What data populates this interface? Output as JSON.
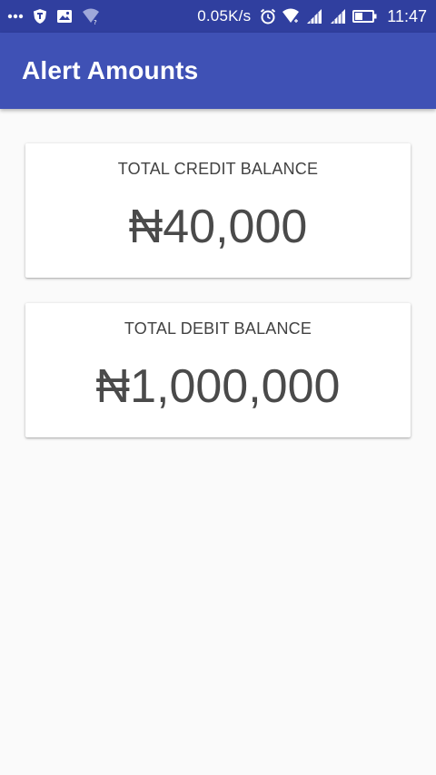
{
  "status_bar": {
    "icons_left": [
      "more-dots-icon",
      "shield-icon",
      "image-icon",
      "wifi-question-icon"
    ],
    "net_speed": "0.05K/s",
    "icons_right": [
      "alarm-icon",
      "wifi-icon",
      "signal-icon",
      "signal-icon",
      "battery-icon"
    ],
    "time": "11:47"
  },
  "app_bar": {
    "title": "Alert Amounts",
    "color": "#3f51b5"
  },
  "cards": {
    "credit": {
      "label": "TOTAL CREDIT BALANCE",
      "amount": "₦40,000"
    },
    "debit": {
      "label": "TOTAL DEBIT BALANCE",
      "amount": "₦1,000,000"
    }
  }
}
